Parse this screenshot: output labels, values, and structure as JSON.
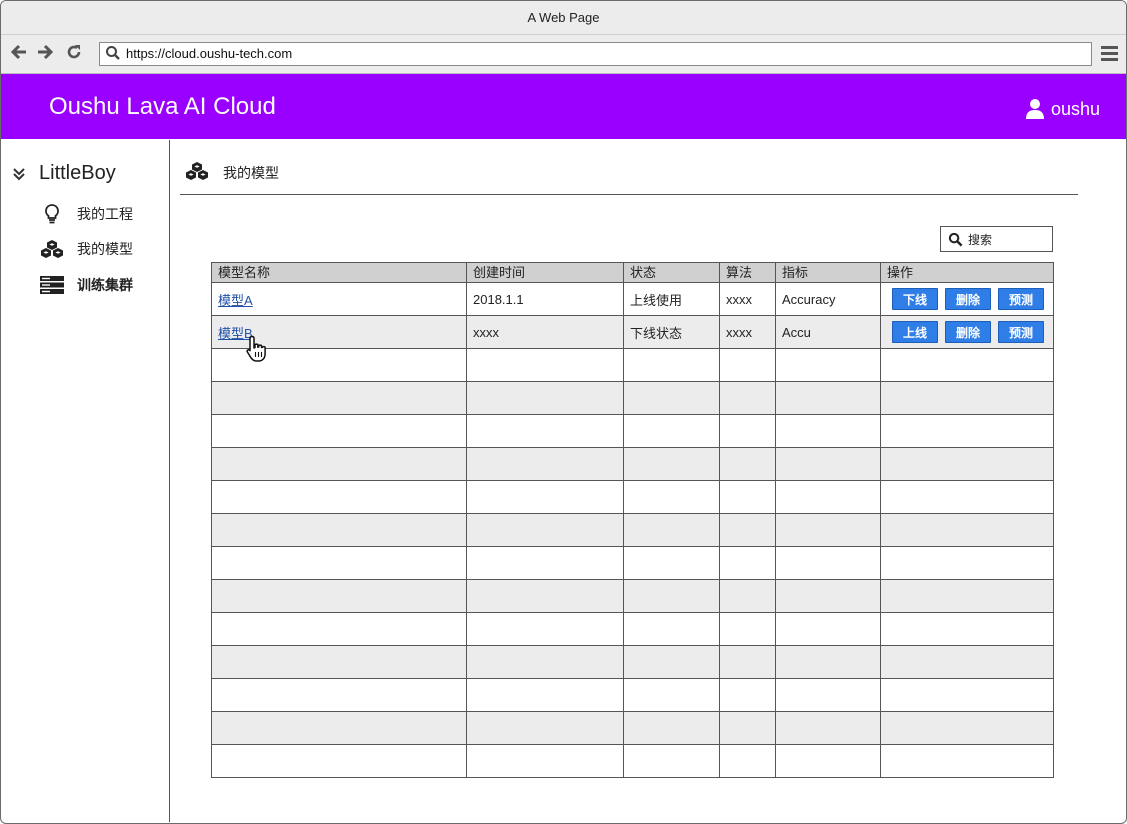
{
  "browser": {
    "window_title": "A Web Page",
    "url": "https://cloud.oushu-tech.com"
  },
  "header": {
    "title": "Oushu Lava AI Cloud",
    "username": "oushu",
    "background": "#9900ff"
  },
  "sidebar": {
    "org": "LittleBoy",
    "items": [
      {
        "label": "我的工程",
        "icon": "lightbulb-icon"
      },
      {
        "label": "我的模型",
        "icon": "cubes-icon"
      },
      {
        "label": "训练集群",
        "icon": "server-icon"
      }
    ]
  },
  "main": {
    "breadcrumb": "我的模型",
    "search_placeholder": "搜索",
    "columns": [
      "模型名称",
      "创建时间",
      "状态",
      "算法",
      "指标",
      "操作"
    ],
    "rows": [
      {
        "name": "模型A",
        "time": "2018.1.1",
        "status": "上线使用",
        "algo": "xxxx",
        "metric": "Accuracy",
        "actions": [
          "下线",
          "删除",
          "预测"
        ]
      },
      {
        "name": "模型B",
        "time": "xxxx",
        "status": "下线状态",
        "algo": "xxxx",
        "metric": "Accu",
        "actions": [
          "上线",
          "删除",
          "预测"
        ]
      }
    ],
    "accent": "#2f7ee8"
  }
}
